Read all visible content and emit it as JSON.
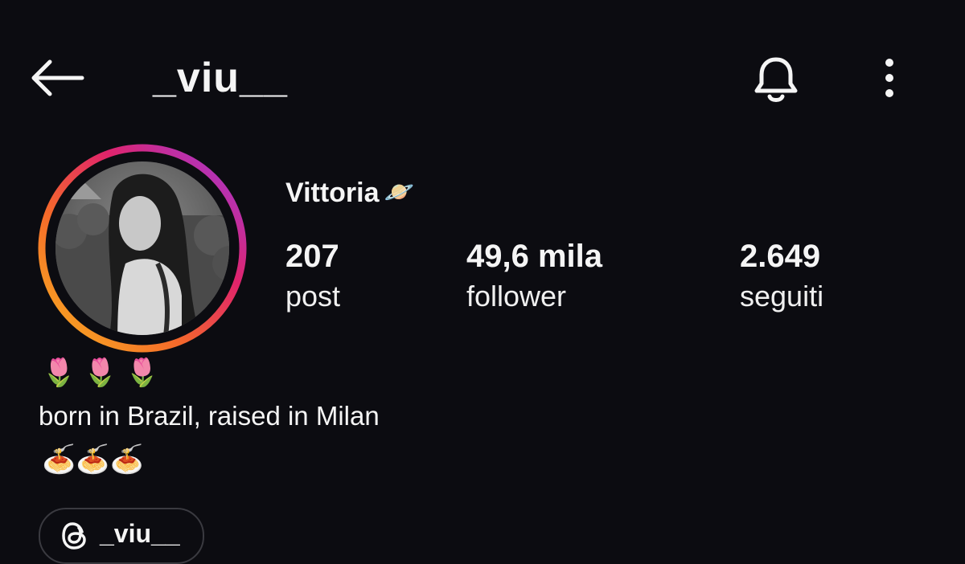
{
  "header": {
    "username": "_viu__",
    "back_icon": "arrow-left-icon",
    "bell_icon": "bell-icon",
    "more_icon": "more-vertical-icon"
  },
  "profile": {
    "display_name": "Vittoria",
    "name_emoji": "🪐",
    "story_ring_colors": [
      "#f9b520",
      "#f56a2a",
      "#e0246b",
      "#c42ab8",
      "#9b3be0"
    ]
  },
  "stats": [
    {
      "value": "207",
      "label": "post"
    },
    {
      "value": "49,6 mila",
      "label": "follower"
    },
    {
      "value": "2.649",
      "label": "seguiti"
    }
  ],
  "bio": {
    "line1": "🌷 🌷 🌷",
    "line2": "born in Brazil, raised in Milan",
    "line3": "🍝🍝🍝"
  },
  "threads": {
    "icon": "threads-icon",
    "handle": "_viu__"
  }
}
